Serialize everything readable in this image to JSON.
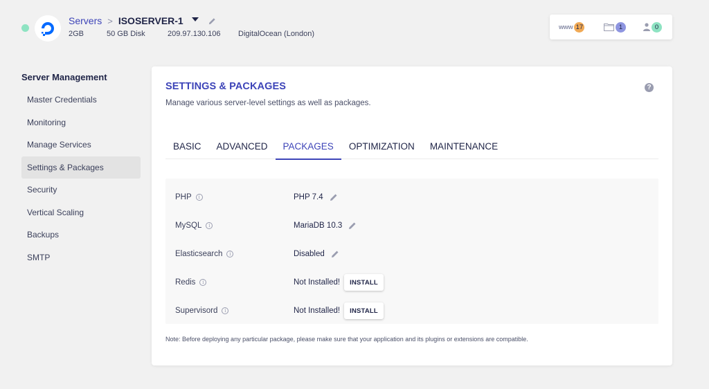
{
  "header": {
    "status_color": "#8ee3c2",
    "logo_icon": "digitalocean-logo",
    "breadcrumb": {
      "root": "Servers",
      "separator": ">",
      "current": "ISOSERVER-1"
    },
    "meta": {
      "ram": "2GB",
      "disk": "50 GB Disk",
      "ip": "209.97.130.106",
      "provider": "DigitalOcean (London)"
    },
    "stats": {
      "www_label": "www",
      "www_count": "17",
      "www_color": "#f0a955",
      "apps_icon": "folder-icon",
      "apps_count": "1",
      "apps_color": "#8e95e0",
      "users_icon": "user-icon",
      "users_count": "0",
      "users_color": "#8ee3c2"
    }
  },
  "sidebar": {
    "title": "Server Management",
    "items": [
      {
        "label": "Master Credentials",
        "active": false
      },
      {
        "label": "Monitoring",
        "active": false
      },
      {
        "label": "Manage Services",
        "active": false
      },
      {
        "label": "Settings & Packages",
        "active": true
      },
      {
        "label": "Security",
        "active": false
      },
      {
        "label": "Vertical Scaling",
        "active": false
      },
      {
        "label": "Backups",
        "active": false
      },
      {
        "label": "SMTP",
        "active": false
      }
    ]
  },
  "main": {
    "title": "SETTINGS & PACKAGES",
    "description": "Manage various server-level settings as well as packages.",
    "help_icon": "?",
    "tabs": [
      {
        "label": "BASIC",
        "active": false
      },
      {
        "label": "ADVANCED",
        "active": false
      },
      {
        "label": "PACKAGES",
        "active": true
      },
      {
        "label": "OPTIMIZATION",
        "active": false
      },
      {
        "label": "MAINTENANCE",
        "active": false
      }
    ],
    "packages": [
      {
        "name": "PHP",
        "value": "PHP 7.4",
        "action": "edit"
      },
      {
        "name": "MySQL",
        "value": "MariaDB 10.3",
        "action": "edit"
      },
      {
        "name": "Elasticsearch",
        "value": "Disabled",
        "action": "edit"
      },
      {
        "name": "Redis",
        "value": "Not Installed!",
        "action": "install",
        "button_label": "INSTALL"
      },
      {
        "name": "Supervisord",
        "value": "Not Installed!",
        "action": "install",
        "button_label": "INSTALL"
      }
    ],
    "note": "Note: Before deploying any particular package, please make sure that your application and its plugins or extensions are compatible."
  },
  "colors": {
    "accent": "#3d44b8",
    "text": "#1f2447",
    "background": "#f1f1f1"
  }
}
